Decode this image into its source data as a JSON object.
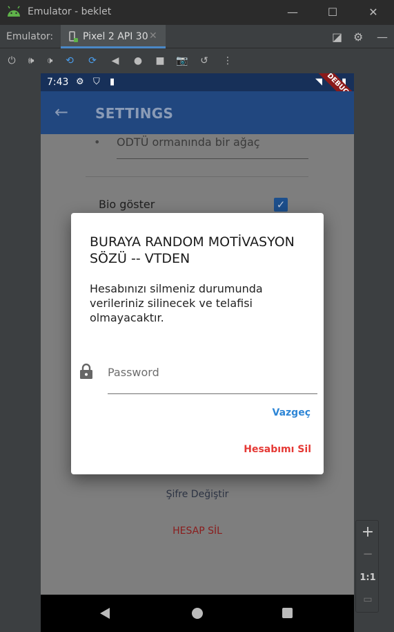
{
  "window": {
    "title": "Emulator - beklet"
  },
  "tabbar": {
    "label": "Emulator:",
    "tab_label": "Pixel 2 API 30"
  },
  "status": {
    "time": "7:43",
    "debug_banner": "DEBUG"
  },
  "appbar": {
    "title": "SETTINGS"
  },
  "settings": {
    "tree_field_value": "ODTÜ ormanında bir ağaç",
    "bio_label": "Bio göster",
    "bio_checked": true,
    "change_password_label": "Şifre Değiştir",
    "delete_account_label": "HESAP SİL"
  },
  "dialog": {
    "title": "BURAYA RANDOM MOTİVASYON SÖZÜ -- VTDEN",
    "body": "Hesabınızı silmeniz durumunda verileriniz silinecek ve telafisi olmayacaktır.",
    "password_placeholder": "Password",
    "cancel_label": "Vazgeç",
    "delete_label": "Hesabımı Sil"
  },
  "zoom": {
    "in": "+",
    "out": "−",
    "ratio": "1:1"
  },
  "colors": {
    "appbar": "#21477f",
    "statusbar": "#173059",
    "accent": "#2e86d6",
    "danger": "#e53935"
  }
}
